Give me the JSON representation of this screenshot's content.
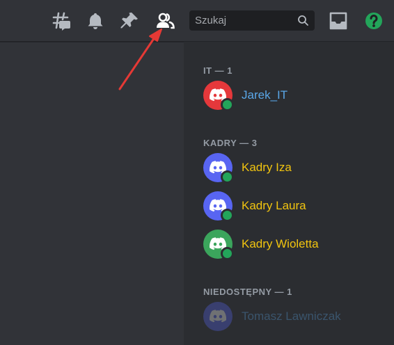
{
  "toolbar": {
    "icons": [
      "threads-icon",
      "bell-icon",
      "pin-icon",
      "members-icon",
      "inbox-icon",
      "help-icon"
    ],
    "search_placeholder": "Szukaj"
  },
  "members": {
    "groups": [
      {
        "title": "IT — 1",
        "members": [
          {
            "name": "Jarek_IT",
            "avatar_color": "#e5383b",
            "name_color": "#5aa7e8",
            "status": "online"
          }
        ]
      },
      {
        "title": "KADRY — 3",
        "members": [
          {
            "name": "Kadry Iza",
            "avatar_color": "#5865f2",
            "name_color": "#f1c40f",
            "status": "online"
          },
          {
            "name": "Kadry Laura",
            "avatar_color": "#5865f2",
            "name_color": "#f1c40f",
            "status": "online"
          },
          {
            "name": "Kadry Wioletta",
            "avatar_color": "#3ba55c",
            "name_color": "#f1c40f",
            "status": "online"
          }
        ]
      },
      {
        "title": "NIEDOSTĘPNY — 1",
        "members": [
          {
            "name": "Tomasz Lawniczak",
            "avatar_color": "#5865f2",
            "name_color": "#5aa7e8",
            "status": "offline"
          }
        ]
      }
    ]
  },
  "colors": {
    "background": "#313338",
    "panel": "#2b2d31",
    "online": "#23a55a",
    "help": "#23a55a",
    "arrow": "#e53935"
  }
}
